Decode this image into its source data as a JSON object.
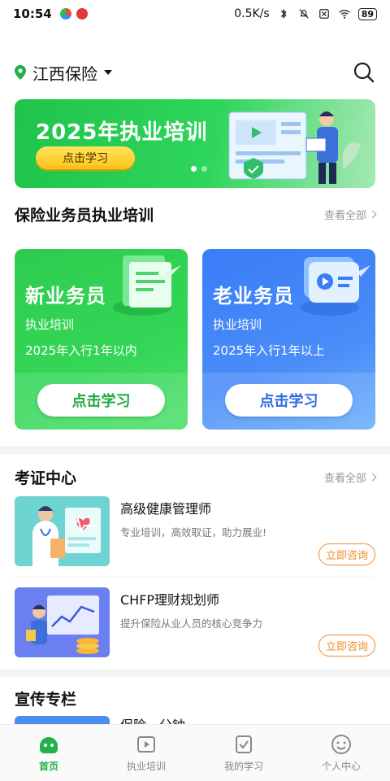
{
  "status_bar": {
    "time": "10:54",
    "speed": "0.5K/s",
    "battery": "89"
  },
  "header": {
    "location": "江西保险"
  },
  "banner": {
    "title": "2025年执业培训",
    "button": "点击学习"
  },
  "training_section": {
    "title": "保险业务员执业培训",
    "more": "查看全部",
    "cards": [
      {
        "title": "新业务员",
        "subtitle": "执业培训",
        "desc": "2025年入行1年以内",
        "button": "点击学习"
      },
      {
        "title": "老业务员",
        "subtitle": "执业培训",
        "desc": "2025年入行1年以上",
        "button": "点击学习"
      }
    ]
  },
  "cert_section": {
    "title": "考证中心",
    "more": "查看全部",
    "items": [
      {
        "title": "高级健康管理师",
        "desc": "专业培训，高效取证，助力展业!",
        "button": "立即咨询"
      },
      {
        "title": "CHFP理财规划师",
        "desc": "提升保险从业人员的核心竞争力",
        "button": "立即咨询"
      }
    ]
  },
  "promo_section": {
    "title": "宣传专栏",
    "first_item": "保险一分钟"
  },
  "tabbar": {
    "tabs": [
      {
        "label": "首页",
        "icon": "home-face-icon"
      },
      {
        "label": "执业培训",
        "icon": "play-icon"
      },
      {
        "label": "我的学习",
        "icon": "check-icon"
      },
      {
        "label": "个人中心",
        "icon": "smile-icon"
      }
    ]
  }
}
